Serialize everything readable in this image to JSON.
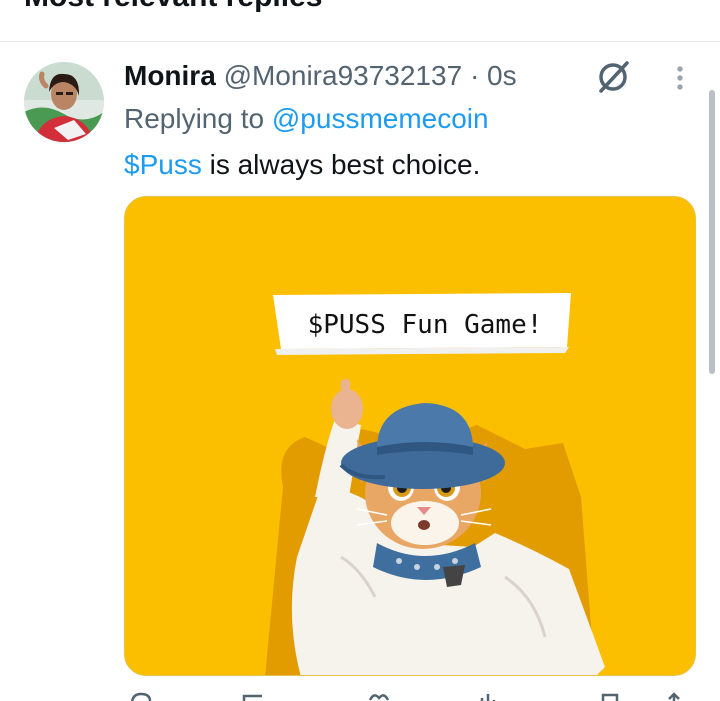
{
  "section": {
    "title": "Most relevant replies"
  },
  "tweet": {
    "author_name": "Monira",
    "handle": "@Monira93732137",
    "separator": "·",
    "timestamp": "0s",
    "reply_prefix": "Replying to",
    "reply_to": "@pussmemecoin",
    "cashtag": "$Puss",
    "text_rest": " is always best choice.",
    "media": {
      "caption": "$PUSS Fun Game!",
      "background_color": "#fbbf00"
    }
  },
  "icons": {
    "grok": "grok-icon",
    "more": "more-vertical-icon",
    "actions": [
      "reply-icon",
      "retweet-icon",
      "like-icon",
      "views-icon",
      "bookmark-icon",
      "share-icon"
    ]
  },
  "colors": {
    "accent": "#1d9bf0",
    "text": "#0f1419",
    "secondary": "#536471"
  }
}
